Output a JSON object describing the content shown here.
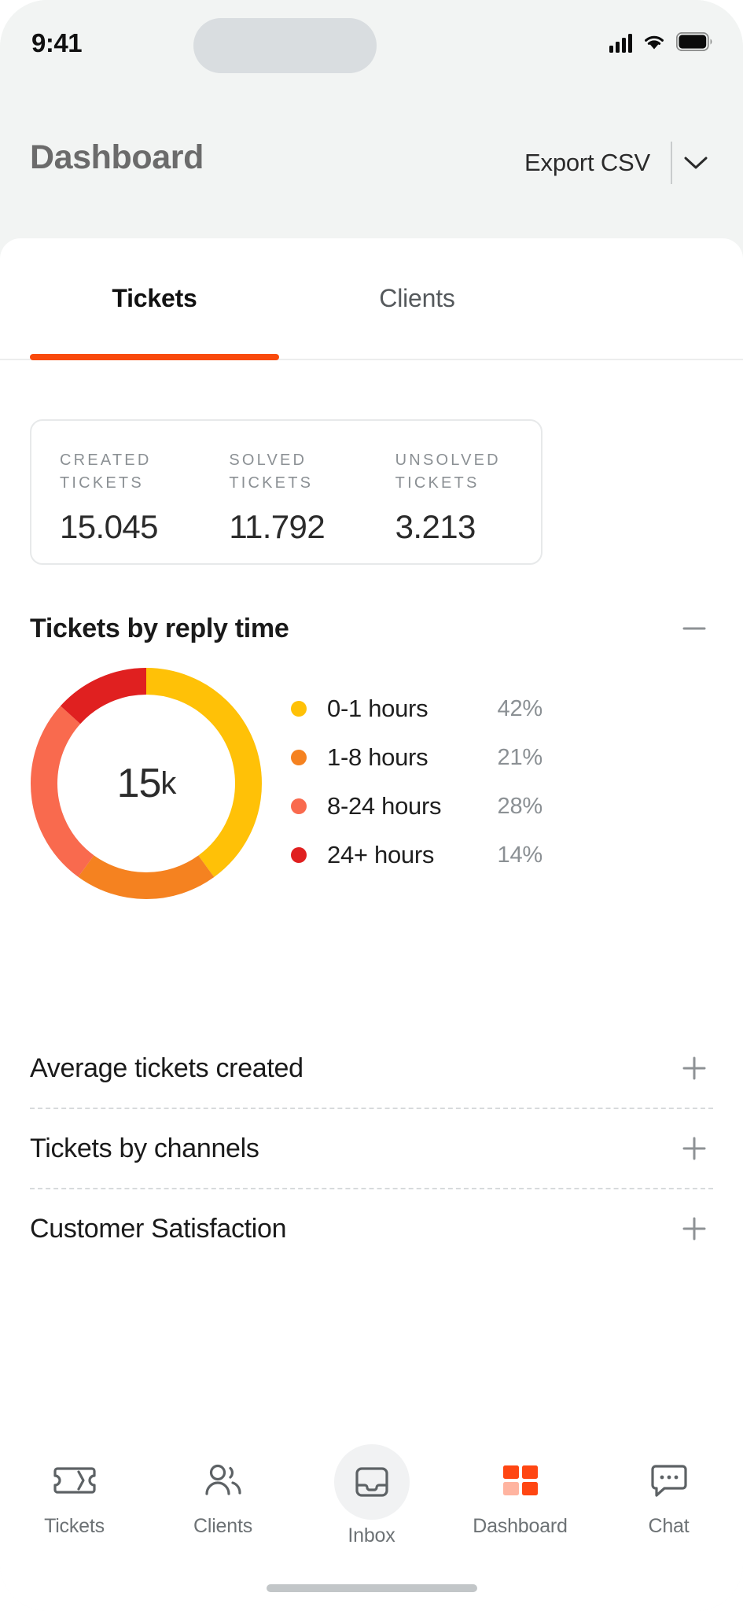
{
  "statusbar": {
    "time": "9:41",
    "cellular_icon": "signal-bars-icon",
    "wifi_icon": "wifi-icon",
    "battery_icon": "battery-full-icon"
  },
  "header": {
    "title": "Dashboard",
    "export_label": "Export CSV",
    "chevron_icon": "chevron-down-icon"
  },
  "tabs": [
    {
      "label": "Tickets",
      "active": true
    },
    {
      "label": "Clients",
      "active": false
    }
  ],
  "stats": [
    {
      "label": "CREATED TICKETS",
      "value": "15.045"
    },
    {
      "label": "SOLVED TICKETS",
      "value": "11.792"
    },
    {
      "label": "UNSOLVED TICKETS",
      "value": "3.213"
    }
  ],
  "reply_time_section": {
    "title": "Tickets by reply time",
    "toggle_icon": "minus-icon",
    "toggle_glyph": "–",
    "expanded": true,
    "center_value": "15",
    "center_suffix": "k"
  },
  "accordions": [
    {
      "title": "Average tickets created",
      "toggle_icon": "plus-icon",
      "toggle_glyph": "+"
    },
    {
      "title": "Tickets by channels",
      "toggle_icon": "plus-icon",
      "toggle_glyph": "+"
    },
    {
      "title": "Customer Satisfaction",
      "toggle_icon": "plus-icon",
      "toggle_glyph": "+"
    }
  ],
  "bottom_nav": [
    {
      "label": "Tickets",
      "icon": "ticket-icon",
      "active": false
    },
    {
      "label": "Clients",
      "icon": "users-icon",
      "active": false
    },
    {
      "label": "Inbox",
      "icon": "inbox-icon",
      "active": false,
      "highlight": true
    },
    {
      "label": "Dashboard",
      "icon": "dashboard-grid-icon",
      "active": true
    },
    {
      "label": "Chat",
      "icon": "chat-bubble-icon",
      "active": false
    }
  ],
  "colors": {
    "accent": "#F94A0C",
    "brand_orange": "#FF4612",
    "track_gray": "#F0F1F2",
    "seg_0_1": "#FFC107",
    "seg_1_8": "#F58220",
    "seg_8_24": "#F96A4E",
    "seg_24p": "#E02020",
    "page_bg": "#F2F4F3",
    "panel_bg": "#FFFFFF",
    "muted_text": "#8B9094"
  },
  "chart_data": {
    "type": "pie",
    "title": "Tickets by reply time",
    "center_label": "15k",
    "legend_position": "right",
    "total_tickets": 15045,
    "categories": [
      "0-1 hours",
      "1-8 hours",
      "8-24 hours",
      "24+ hours"
    ],
    "values": [
      42,
      21,
      28,
      14
    ],
    "value_labels": [
      "42%",
      "21%",
      "28%",
      "14%"
    ],
    "colors": [
      "#FFC107",
      "#F58220",
      "#F96A4E",
      "#E02020"
    ],
    "unit": "%",
    "start_angle_deg": 0,
    "direction": "clockwise",
    "inner_radius_ratio": 0.62,
    "series": [
      {
        "name": "0-1 hours",
        "value": 42,
        "color": "#FFC107"
      },
      {
        "name": "1-8 hours",
        "value": 21,
        "color": "#F58220"
      },
      {
        "name": "8-24 hours",
        "value": 28,
        "color": "#F96A4E"
      },
      {
        "name": "24+ hours",
        "value": 14,
        "color": "#E02020"
      }
    ]
  }
}
